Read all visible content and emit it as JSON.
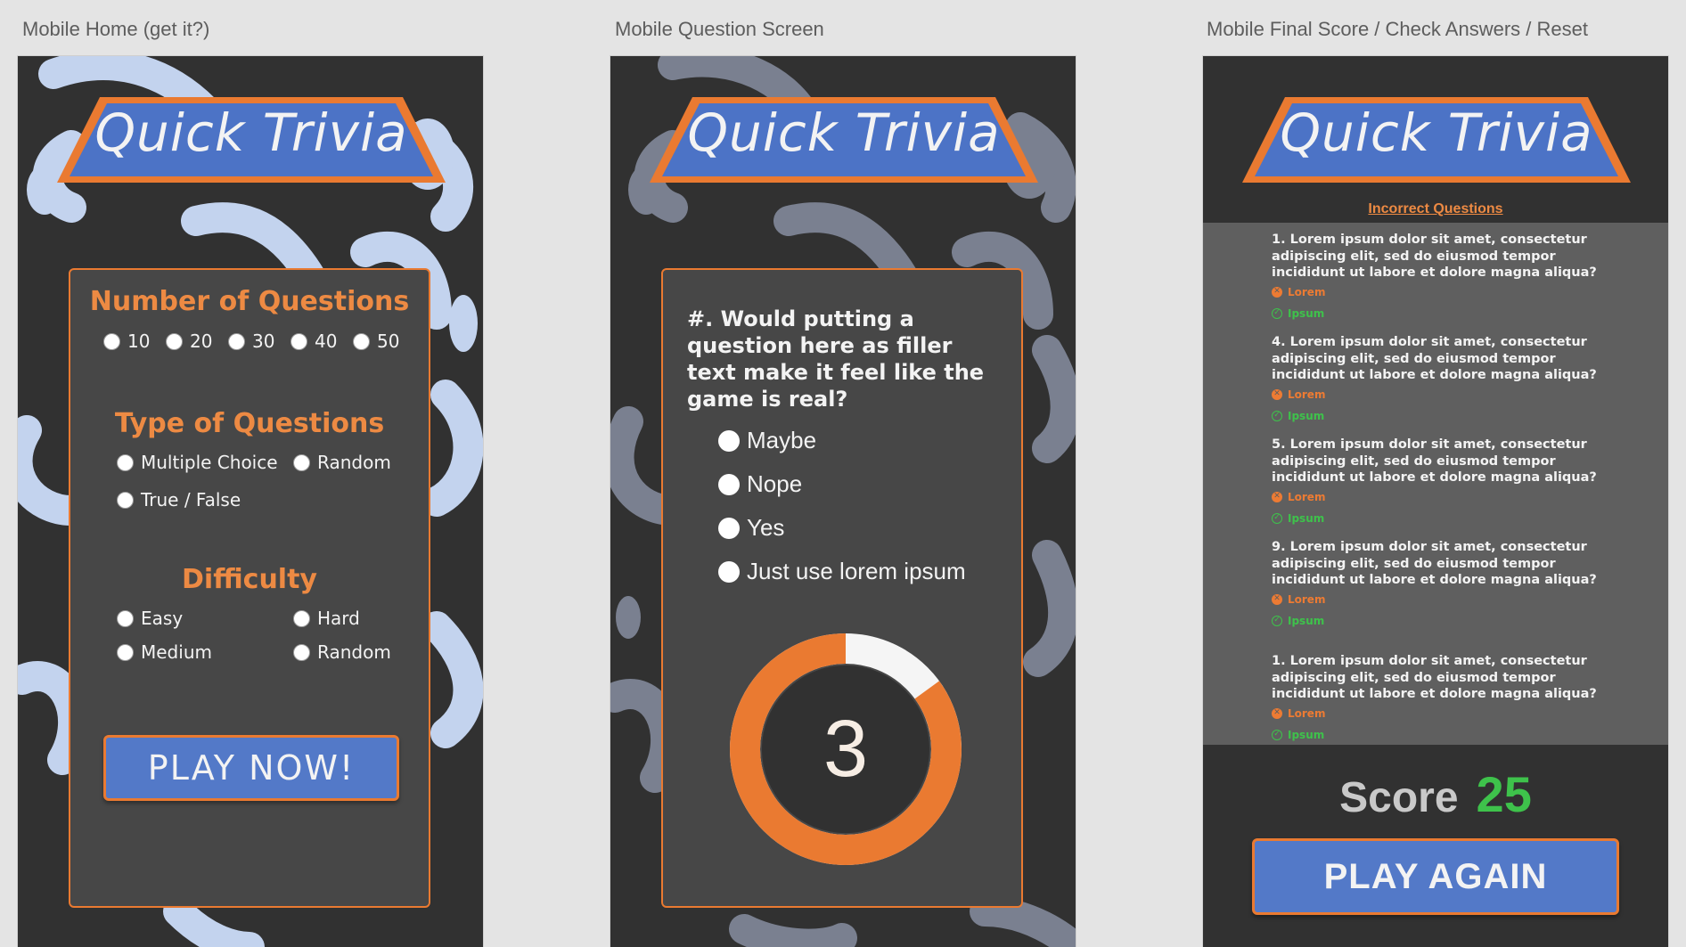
{
  "artboards": {
    "home_label": "Mobile Home (get it?)",
    "question_label": "Mobile Question Screen",
    "final_label": "Mobile Final Score / Check Answers / Reset"
  },
  "brand": {
    "title": "Quick Trivia",
    "accent_color": "#ea7a31",
    "banner_color": "#4c73c6",
    "background_color": "#313131"
  },
  "home": {
    "number_title": "Number of Questions",
    "number_options": [
      "10",
      "20",
      "30",
      "40",
      "50"
    ],
    "type_title": "Type of Questions",
    "type_options": [
      "Multiple Choice",
      "Random",
      "True / False"
    ],
    "difficulty_title": "Difficulty",
    "difficulty_options": [
      "Easy",
      "Hard",
      "Medium",
      "Random"
    ],
    "play_button": "PLAY NOW!"
  },
  "question": {
    "text": "#. Would putting a question here as filler text make it feel like the game is real?",
    "answers": [
      "Maybe",
      "Nope",
      "Yes",
      "Just use lorem ipsum"
    ],
    "timer_value": "3",
    "timer_remaining_fraction": 0.85
  },
  "final": {
    "incorrect_title": "Incorrect Questions",
    "items": [
      {
        "question": "1. Lorem ipsum dolor sit amet, consectetur adipiscing elit, sed do eiusmod tempor incididunt ut labore et dolore magna aliqua?",
        "wrong": "Lorem",
        "right": "Ipsum"
      },
      {
        "question": "4. Lorem ipsum dolor sit amet, consectetur adipiscing elit, sed do eiusmod tempor incididunt ut labore et dolore magna aliqua?",
        "wrong": "Lorem",
        "right": "Ipsum"
      },
      {
        "question": "5. Lorem ipsum dolor sit amet, consectetur adipiscing elit, sed do eiusmod tempor incididunt ut labore et dolore magna aliqua?",
        "wrong": "Lorem",
        "right": "Ipsum"
      },
      {
        "question": "9. Lorem ipsum dolor sit amet, consectetur adipiscing elit, sed do eiusmod tempor incididunt ut labore et dolore magna aliqua?",
        "wrong": "Lorem",
        "right": "Ipsum"
      },
      {
        "question": "1. Lorem ipsum dolor sit amet, consectetur adipiscing elit, sed do eiusmod tempor incididunt ut labore et dolore magna aliqua?",
        "wrong": "Lorem",
        "right": "Ipsum"
      }
    ],
    "score_label": "Score",
    "score_value": "25",
    "play_again": "PLAY AGAIN"
  }
}
